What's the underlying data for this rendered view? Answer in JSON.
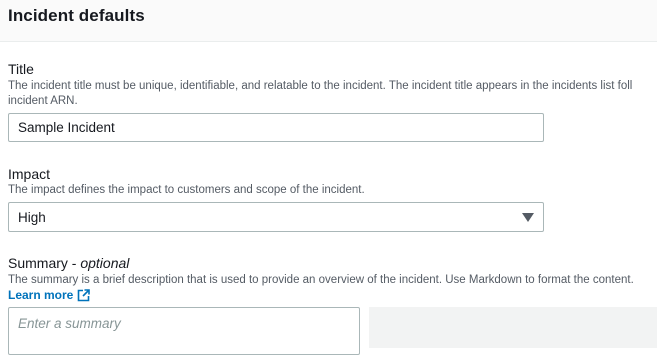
{
  "section": {
    "title": "Incident defaults"
  },
  "fields": {
    "title": {
      "label": "Title",
      "description_line1": "The incident title must be unique, identifiable, and relatable to the incident. The incident title appears in the incidents list foll",
      "description_line2": "incident ARN.",
      "value": "Sample Incident"
    },
    "impact": {
      "label": "Impact",
      "description": "The impact defines the impact to customers and scope of the incident.",
      "selected": "High"
    },
    "summary": {
      "label": "Summary - ",
      "optional": "optional",
      "description": "The summary is a brief description that is used to provide an overview of the incident. Use Markdown to format the content.",
      "learn_more": "Learn more",
      "placeholder": "Enter a summary"
    }
  },
  "colors": {
    "link": "#0073bb",
    "border": "#aab7b8",
    "description": "#545b64"
  },
  "icons": {
    "external_link": "external-link-icon",
    "dropdown": "caret-down-icon"
  }
}
